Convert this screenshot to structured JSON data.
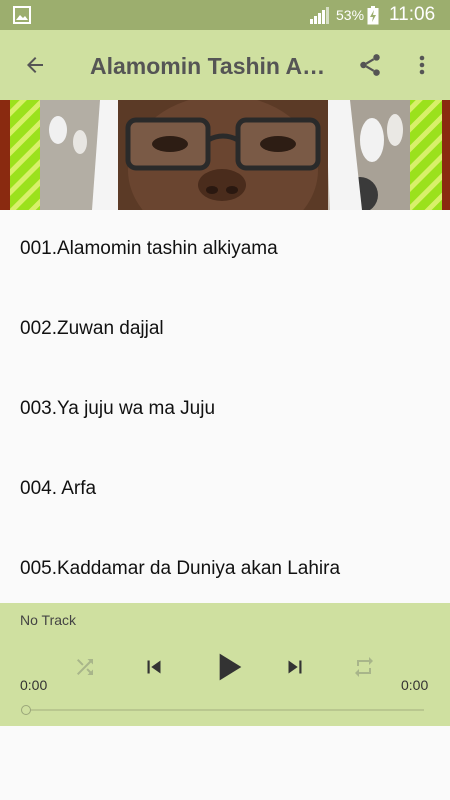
{
  "status_bar": {
    "battery_percent": "53%",
    "time": "11:06",
    "icons": [
      "gallery-icon",
      "signal-icon",
      "battery-charging-icon"
    ]
  },
  "toolbar": {
    "title": "Alamomin Tashin Alkiyama",
    "icons": [
      "back-arrow-icon",
      "share-icon",
      "more-vert-icon"
    ]
  },
  "tracks": [
    {
      "label": "001.Alamomin tashin alkiyama"
    },
    {
      "label": "002.Zuwan dajjal"
    },
    {
      "label": "003.Ya juju wa ma Juju"
    },
    {
      "label": "004. Arfa"
    },
    {
      "label": "005.Kaddamar da Duniya akan Lahira"
    }
  ],
  "player": {
    "now_playing": "No Track",
    "elapsed": "0:00",
    "duration": "0:00",
    "progress": 0,
    "icons": [
      "shuffle-icon",
      "skip-previous-icon",
      "play-icon",
      "skip-next-icon",
      "repeat-icon"
    ]
  },
  "colors": {
    "status_bar": "#9cae6e",
    "toolbar": "#cfe0a0",
    "player": "#cfe0a0",
    "list_background": "#fafafa"
  }
}
